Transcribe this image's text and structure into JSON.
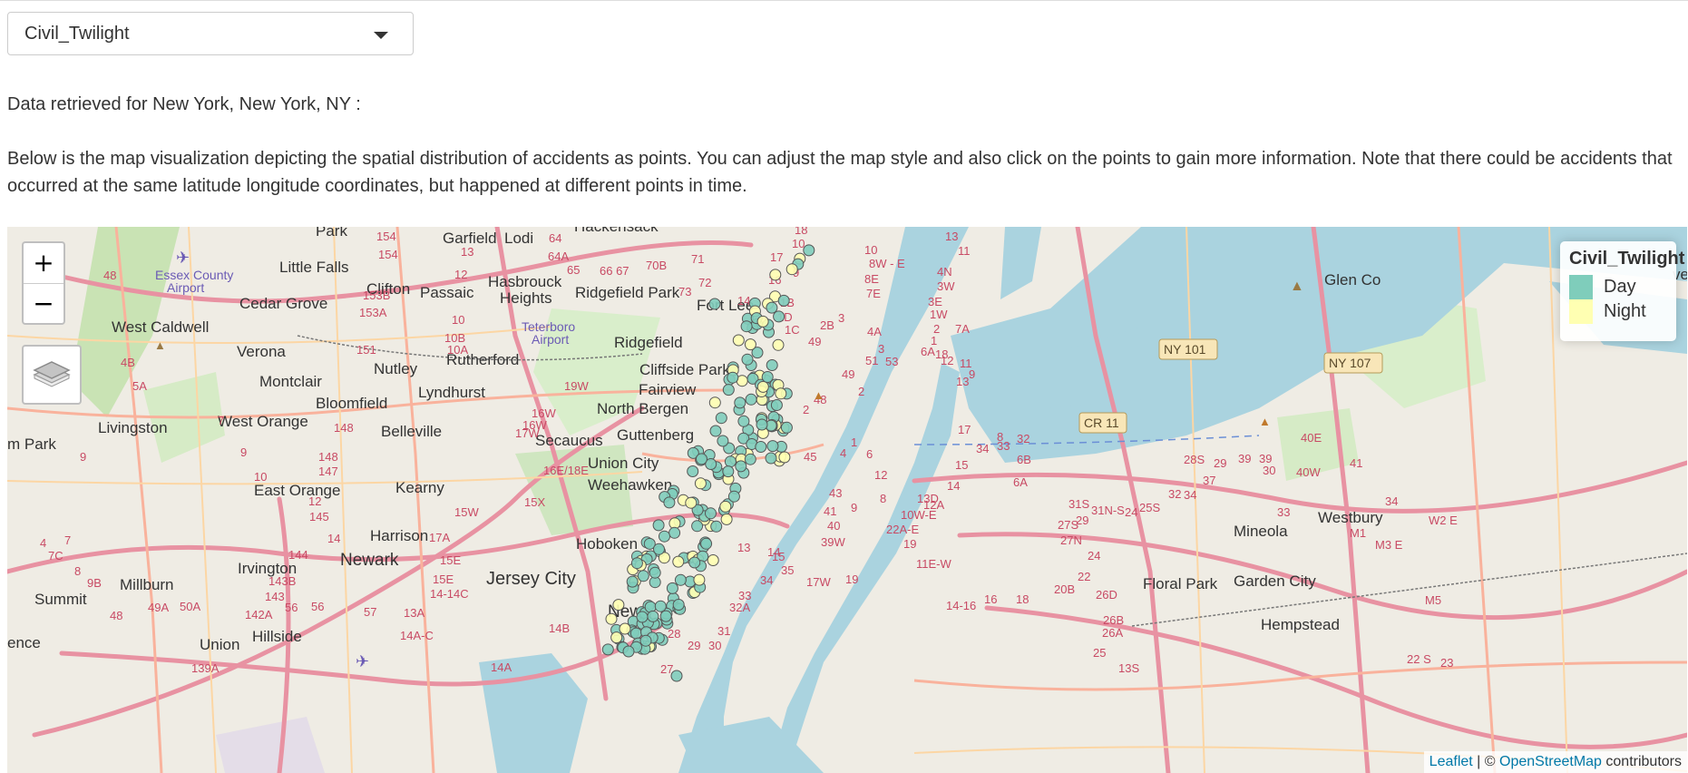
{
  "selector": {
    "value": "Civil_Twilight"
  },
  "intro": {
    "location_line": "Data retrieved for New York, New York, NY :",
    "description": "Below is the map visualization depicting the spatial distribution of accidents as points. You can adjust the map style and also click on the points to gain more information. Note that there could be accidents that occurred at the same latitude longitude coordinates, but happened at different points in time."
  },
  "map": {
    "zoom_in_label": "+",
    "zoom_out_label": "−",
    "layers_icon": "layers-icon",
    "legend": {
      "title": "Civil_Twilight",
      "items": [
        {
          "label": "Day",
          "color": "#7fcdbb"
        },
        {
          "label": "Night",
          "color": "#ffffb2"
        }
      ]
    },
    "attribution": {
      "leaflet": "Leaflet",
      "separator": " | © ",
      "osm": "OpenStreetMap",
      "suffix": " contributors"
    },
    "place_labels": [
      "Park",
      "Garfield",
      "Lodi",
      "Hackensack",
      "Little Falls",
      "Essex County Airport",
      "Clifton",
      "Passaic",
      "Hasbrouck Heights",
      "Ridgefield Park",
      "Fort Lee",
      "Cedar Grove",
      "West Caldwell",
      "Teterboro Airport",
      "Ridgefield",
      "Verona",
      "Rutherford",
      "Nutley",
      "Cliffside Park",
      "Montclair",
      "Lyndhurst",
      "Fairview",
      "Bloomfield",
      "North Bergen",
      "Livingston",
      "West Orange",
      "Belleville",
      "Guttenberg",
      "m Park",
      "Secaucus",
      "Union City",
      "East Orange",
      "Kearny",
      "Weehawken",
      "Harrison",
      "Newark",
      "Hoboken",
      "Irvington",
      "Jersey City",
      "Millburn",
      "Summit",
      "New",
      "Union",
      "Hillside",
      "ence",
      "Glen Co",
      "Mineola",
      "Westbury",
      "Floral Park",
      "Garden City",
      "Hempstead",
      "vei"
    ],
    "road_shields": [
      "NY 101",
      "NY 107",
      "CR 11"
    ]
  },
  "accident_colors": {
    "day": "#7fcdbb",
    "night": "#ffffb2",
    "stroke": "#555555"
  }
}
